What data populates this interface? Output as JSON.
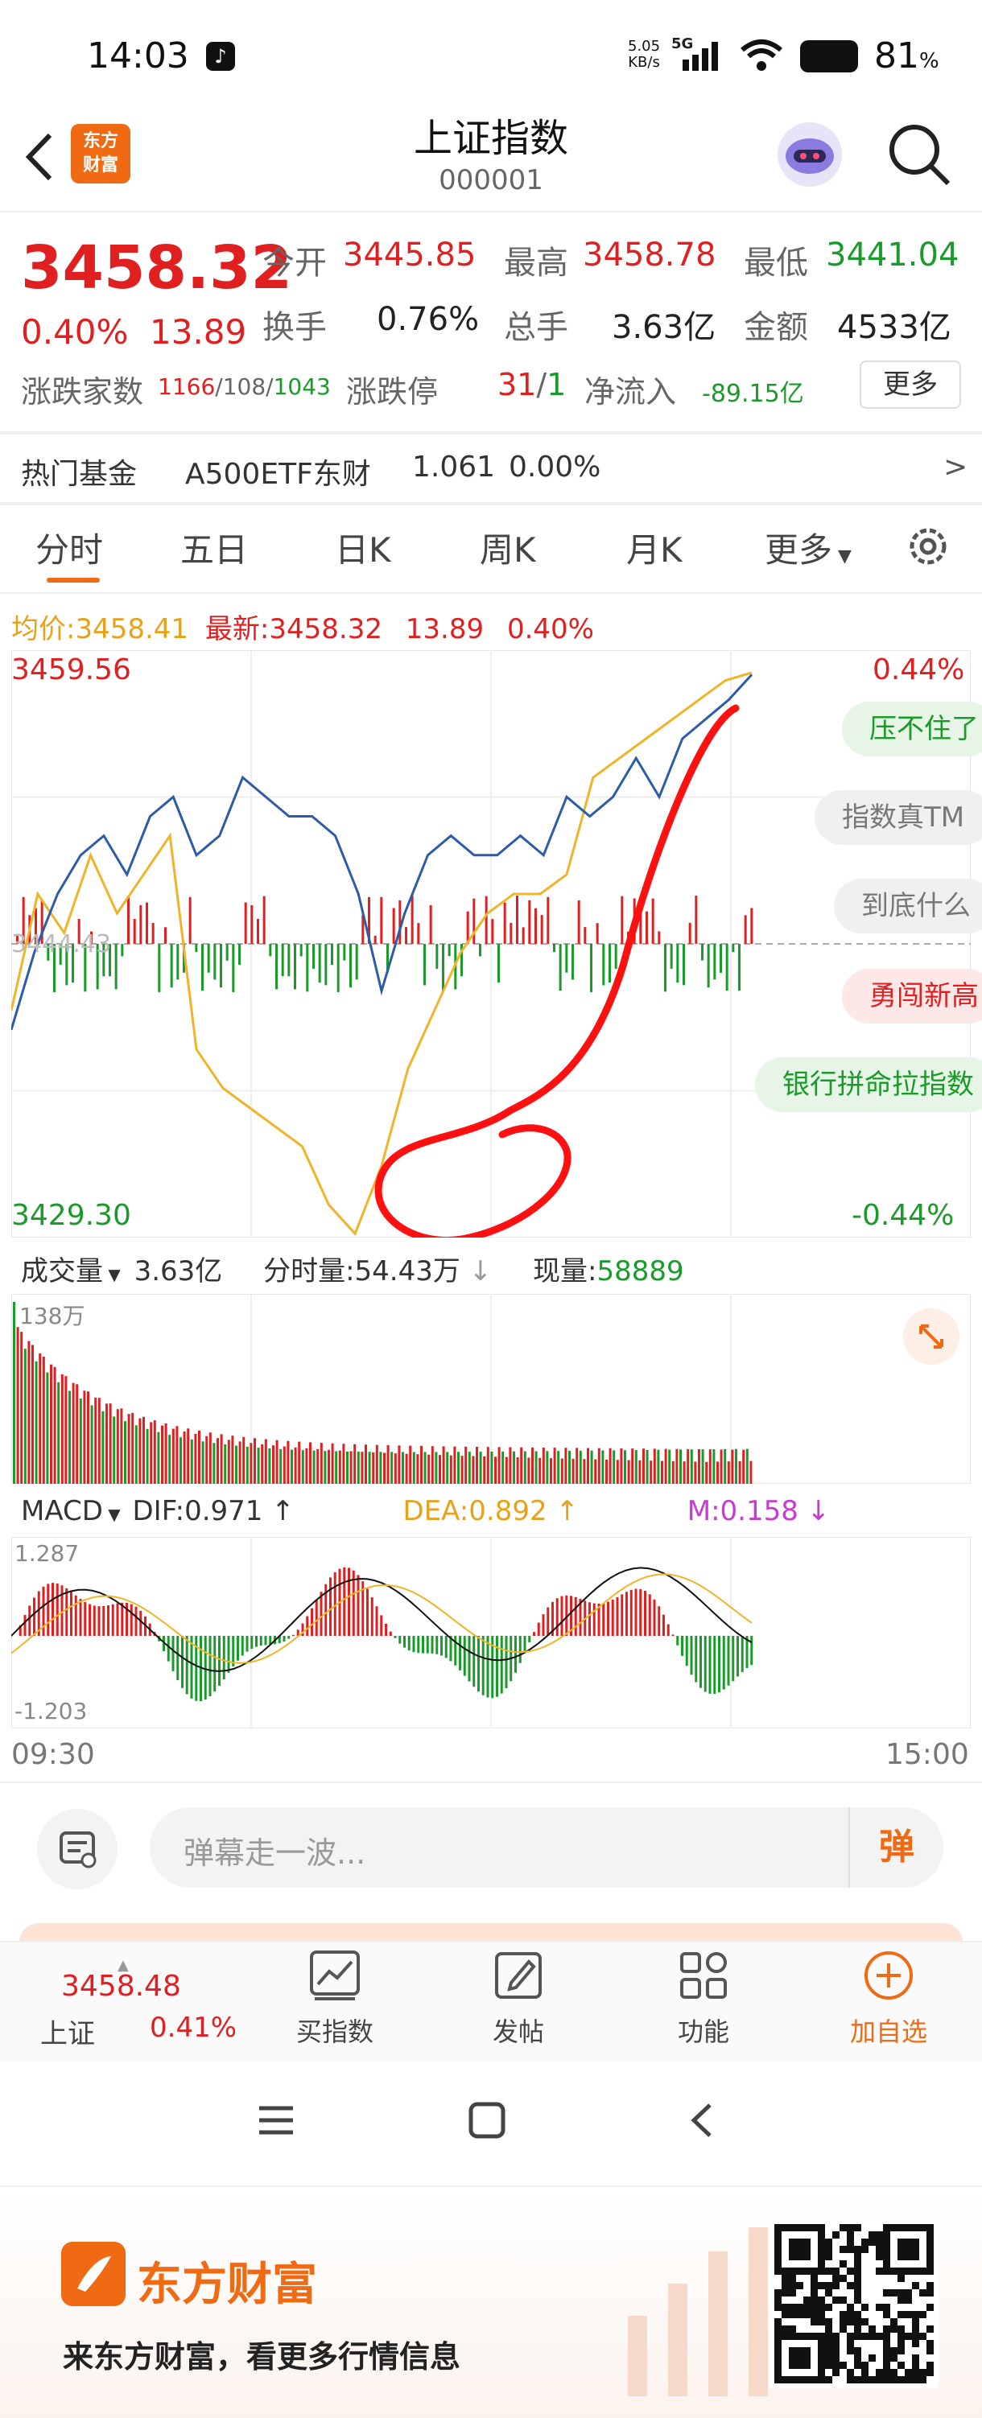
{
  "status_bar": {
    "time": "14:03",
    "net_speed_top": "5.05",
    "net_speed_bottom": "KB/s",
    "net_type": "5G",
    "battery": "81",
    "battery_unit": "%"
  },
  "header": {
    "title": "上证指数",
    "code": "000001",
    "logo_line1": "东方",
    "logo_line2": "财富"
  },
  "quote": {
    "price": "3458.32",
    "change_pct": "0.40%",
    "change_abs": "13.89",
    "open_label": "今开",
    "open": "3445.85",
    "high_label": "最高",
    "high": "3458.78",
    "low_label": "最低",
    "low": "3441.04",
    "turnover_label": "换手",
    "turnover": "0.76%",
    "volume_label": "总手",
    "volume": "3.63亿",
    "amount_label": "金额",
    "amount": "4533亿",
    "breadth_label": "涨跌家数",
    "breadth_up": "1166",
    "breadth_flat": "108",
    "breadth_down": "1043",
    "limit_label": "涨跌停",
    "limit_up": "31",
    "limit_down": "1",
    "inflow_label": "净流入",
    "inflow": "-89.15亿",
    "more_button": "更多"
  },
  "hot_fund": {
    "label": "热门基金",
    "name": "A500ETF东财",
    "price": "1.061",
    "change": "0.00%",
    "arrow": ">"
  },
  "tabs": [
    "分时",
    "五日",
    "日K",
    "周K",
    "月K",
    "更多"
  ],
  "chart_info": {
    "avg_label": "均价:",
    "avg": "3458.41",
    "latest_label": "最新:",
    "latest": "3458.32",
    "latest_change": "13.89",
    "latest_pct": "0.40%",
    "y_top": "3459.56",
    "y_bottom": "3429.30",
    "pct_top": "0.44%",
    "pct_bottom": "-0.44%",
    "mid_label": "3444.43"
  },
  "bubbles": [
    "压不住了",
    "指数真TM",
    "到底什么",
    "勇闯新高",
    "银行拼命拉指数"
  ],
  "volume_bar": {
    "label": "成交量",
    "total": "3.63亿",
    "period_label": "分时量:",
    "period": "54.43万",
    "current_label": "现量:",
    "current": "58889",
    "max_label": "138万"
  },
  "macd": {
    "label": "MACD",
    "dif": "DIF:0.971",
    "dea": "DEA:0.892",
    "m": "M:0.158",
    "top": "1.287",
    "bottom": "-1.203"
  },
  "time_axis": {
    "start": "09:30",
    "end": "15:00"
  },
  "comment": {
    "placeholder": "弹幕走一波...",
    "button": "弹"
  },
  "bottom_nav": {
    "index_price": "3458.48",
    "index_name": "上证",
    "index_pct": "0.41%",
    "buy": "买指数",
    "post": "发帖",
    "func": "功能",
    "add": "加自选"
  },
  "footer": {
    "brand": "东方财富",
    "slogan": "来东方财富，看更多行情信息"
  },
  "colors": {
    "up": "#e02020",
    "down": "#1a9a2a",
    "accent": "#f06a14",
    "price_line": "#2a5caa",
    "avg_line": "#f0b429"
  },
  "chart_data": {
    "type": "line",
    "x_range": [
      "09:30",
      "15:00"
    ],
    "ylim": [
      3429.3,
      3459.56
    ],
    "prev_close": 3444.43,
    "series": [
      {
        "values": [
          3440,
          3444,
          3447,
          3449,
          3450,
          3448,
          3451,
          3452,
          3449,
          3450,
          3453,
          3452,
          3451,
          3451,
          3450,
          3447,
          3442,
          3446,
          3449,
          3450,
          3449,
          3449,
          3450,
          3449,
          3452,
          3451,
          3452,
          3454,
          3452,
          3455,
          3456,
          3457,
          3458.3
        ]
      },
      {
        "values": [
          3441,
          3447,
          3445,
          3449,
          3446,
          3448,
          3450,
          3439,
          3437,
          3436,
          3435,
          3434,
          3431,
          3429.5,
          3433,
          3438,
          3441,
          3444,
          3446,
          3447,
          3447,
          3448,
          3453,
          3454,
          3455,
          3456,
          3457,
          3458,
          3458.4
        ]
      }
    ],
    "volume_max": "138万",
    "macd_range": [
      -1.203,
      1.287
    ]
  }
}
